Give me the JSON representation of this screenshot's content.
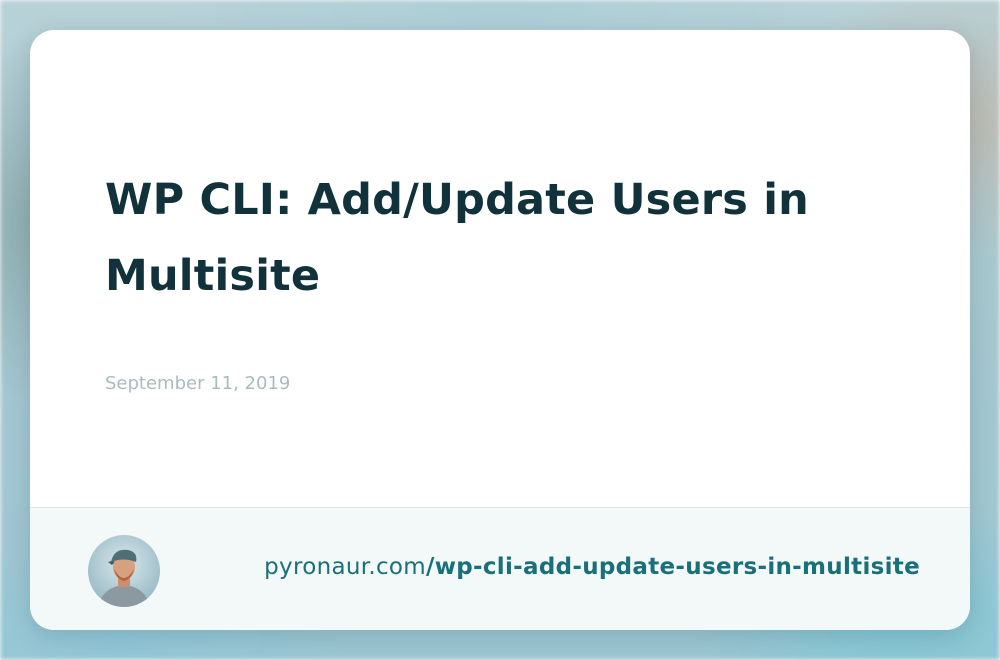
{
  "post": {
    "title": "WP CLI: Add/Update Users in Multisite",
    "date": "September 11, 2019"
  },
  "footer": {
    "avatar_icon": "avatar-photo",
    "url_domain": "pyronaur.com",
    "url_path": "/wp-cli-add-update-users-in-multisite"
  },
  "colors": {
    "title": "#11323a",
    "date": "#a8bcc0",
    "link": "#1a7078",
    "footer_bg": "#f3f8f9"
  }
}
